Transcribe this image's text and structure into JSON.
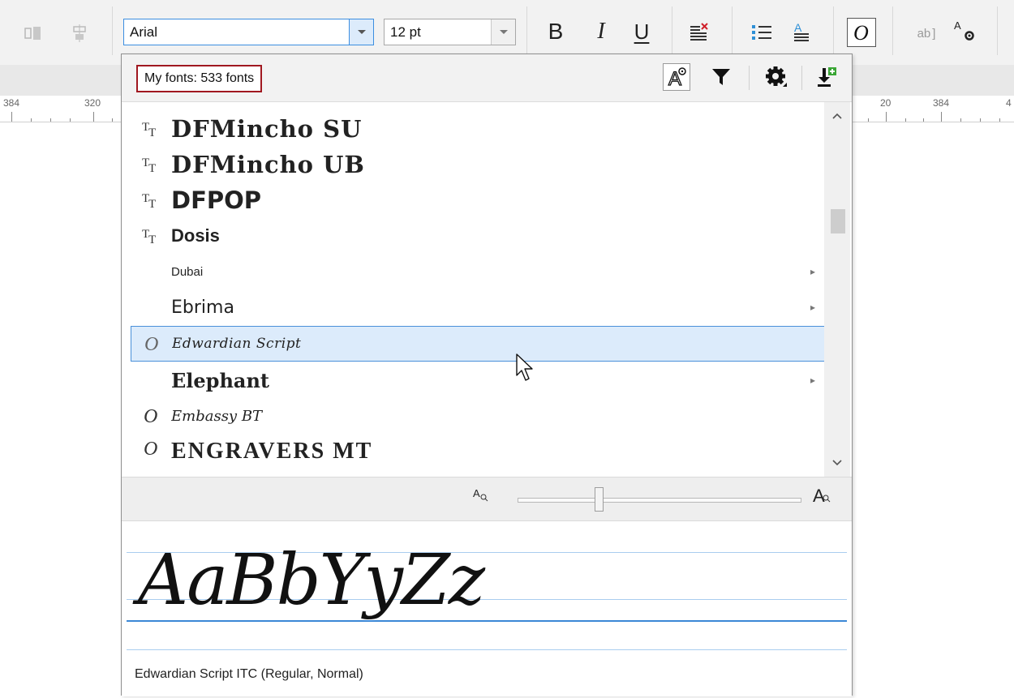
{
  "toolbar": {
    "font_family_value": "Arial",
    "font_size_value": "12 pt",
    "bold_label": "B",
    "italic_label": "I",
    "underline_label": "U",
    "icons": [
      "align-left-disabled-icon",
      "align-center-disabled-icon",
      "bold-icon",
      "italic-icon",
      "underline-icon",
      "clear-format-icon",
      "bullet-list-icon",
      "text-format-icon",
      "italic-o-icon",
      "edit-text-icon",
      "character-settings-icon"
    ],
    "ab_label": "ab",
    "char_settings_label": "A"
  },
  "ruler": {
    "labels_left": [
      "384",
      "320"
    ],
    "labels_right": [
      "20",
      "384",
      "4"
    ]
  },
  "font_dropdown": {
    "count_label": "My fonts: 533 fonts",
    "header_buttons": [
      "font-preview-icon",
      "filter-icon",
      "settings-icon",
      "download-fonts-icon"
    ],
    "fonts": [
      {
        "name": "DFMincho SU",
        "icon": "truetype-icon",
        "submenu": false,
        "selected": false
      },
      {
        "name": "DFMincho UB",
        "icon": "truetype-icon",
        "submenu": false,
        "selected": false
      },
      {
        "name": "DFPOP",
        "icon": "truetype-icon",
        "submenu": false,
        "selected": false
      },
      {
        "name": "Dosis",
        "icon": "truetype-icon",
        "submenu": false,
        "selected": false
      },
      {
        "name": "Dubai",
        "icon": "",
        "submenu": true,
        "selected": false
      },
      {
        "name": "Ebrima",
        "icon": "",
        "submenu": true,
        "selected": false
      },
      {
        "name": "Edwardian Script",
        "icon": "opentype-icon",
        "submenu": false,
        "selected": true
      },
      {
        "name": "Elephant",
        "icon": "",
        "submenu": true,
        "selected": false
      },
      {
        "name": "Embassy BT",
        "icon": "opentype-icon",
        "submenu": false,
        "selected": false
      },
      {
        "name": "ENGRAVERS MT",
        "icon": "opentype-icon",
        "submenu": false,
        "selected": false
      }
    ],
    "zoom_small_label": "A",
    "zoom_large_label": "A",
    "zoom_level": 0.28,
    "preview_sample": "AaBbYyZz",
    "preview_description": "Edwardian Script ITC (Regular, Normal)"
  }
}
